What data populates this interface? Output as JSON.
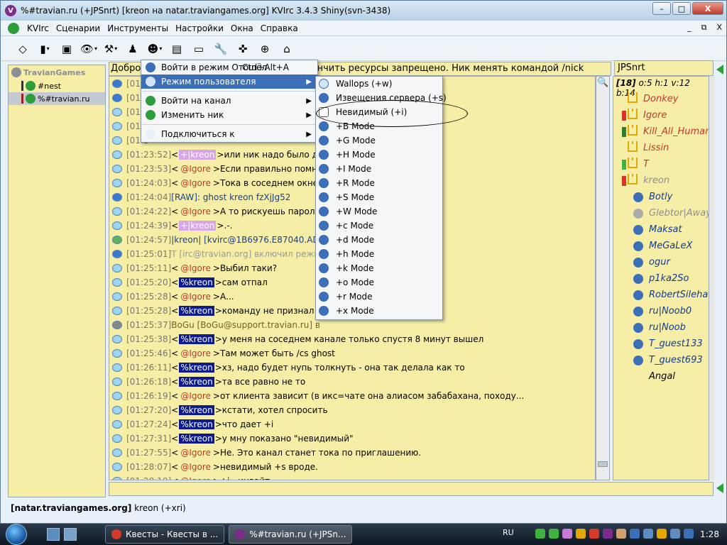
{
  "window": {
    "title": "%#travian.ru (+JPSnrt) [kreon на natar.traviangames.org] KVIrc 3.4.3 Shiny(svn-3438)",
    "app_icon_glyph": "V",
    "controls": [
      "–",
      "□",
      "X"
    ]
  },
  "menubar": {
    "items": [
      "KVIrc",
      "Сценарии",
      "Инструменты",
      "Настройки",
      "Окна",
      "Справка"
    ],
    "mdi_controls": [
      "_",
      "⧉",
      "X"
    ]
  },
  "toolbar": {
    "buttons": [
      {
        "name": "eraser-icon",
        "glyph": "◇"
      },
      {
        "name": "server-icon",
        "glyph": "▮"
      },
      {
        "name": "window-options-icon",
        "glyph": "▣"
      },
      {
        "name": "eye-icon",
        "glyph": "👁"
      },
      {
        "name": "tools-icon",
        "glyph": "⚒"
      },
      {
        "name": "joystick-icon",
        "glyph": "♟"
      },
      {
        "name": "user-icon",
        "glyph": "☻"
      },
      {
        "name": "notes-icon",
        "glyph": "▤"
      },
      {
        "name": "terminal-icon",
        "glyph": "▭"
      },
      {
        "name": "wrench-icon",
        "glyph": "🔧"
      },
      {
        "name": "tool-set-icon",
        "glyph": "✜"
      },
      {
        "name": "lifebuoy-icon",
        "glyph": "⊕"
      },
      {
        "name": "home-icon",
        "glyph": "⌂"
      }
    ]
  },
  "tree": {
    "root": "TravianGames",
    "items": [
      {
        "label": "#nest",
        "bar": "dark"
      },
      {
        "label": "%#travian.ru",
        "bar": "red",
        "selected": true
      }
    ]
  },
  "topic": "Добро пожаловать на канал Травиан! Клянчить ресурсы запрещено. Ник менять командой /nick",
  "chat": [
    {
      "type": "raw",
      "ts": "[01:2",
      "nick": "",
      "nick_class": "",
      "text": ""
    },
    {
      "type": "raw",
      "ts": "[01:2",
      "nick": "",
      "nick_class": "",
      "text": ""
    },
    {
      "type": "msg",
      "ts": "[01:2",
      "nick": "",
      "nick_class": "",
      "text": ""
    },
    {
      "type": "msg",
      "ts": "[01:2",
      "nick": "",
      "nick_class": "",
      "text": ""
    },
    {
      "type": "msg",
      "ts": "[01:2",
      "nick": "",
      "nick_class": "",
      "text": ""
    },
    {
      "type": "msg",
      "ts": "[01:23:52]",
      "nick": "+|kreon",
      "nick_class": "voice",
      "text": "или ник надо было дон"
    },
    {
      "type": "msg",
      "ts": "[01:23:53]",
      "nick": "@Igore",
      "nick_class": "op",
      "text": "Если правильно помн"
    },
    {
      "type": "msg",
      "ts": "[01:24:03]",
      "nick": "@Igore",
      "nick_class": "op",
      "text": "Тока в соседнем окне."
    },
    {
      "type": "raw",
      "ts": "[01:24:04]",
      "nick": "",
      "nick_class": "",
      "text": "[RAW]: ghost kreon fzXjJg52"
    },
    {
      "type": "msg",
      "ts": "[01:24:22]",
      "nick": "@Igore",
      "nick_class": "op",
      "text": "А то рискуешь пароль"
    },
    {
      "type": "msg",
      "ts": "[01:24:39]",
      "nick": "+|kreon",
      "nick_class": "voice",
      "text": ".-."
    },
    {
      "type": "join",
      "ts": "[01:24:57]",
      "nick": "",
      "nick_class": "",
      "text": "|kreon| [kvirc@1B6976.E87040.AD9                        н как kreon"
    },
    {
      "type": "raw",
      "ts": "[01:25:01]",
      "nick": "",
      "nick_class": "",
      "text": "T [irc@travian.org] включил режи"
    },
    {
      "type": "msg",
      "ts": "[01:25:11]",
      "nick": "@Igore",
      "nick_class": "op",
      "text": "Выбил таки?"
    },
    {
      "type": "msg",
      "ts": "[01:25:20]",
      "nick": "%kreon",
      "nick_class": "hop",
      "text": "сам отпал"
    },
    {
      "type": "msg",
      "ts": "[01:25:28]",
      "nick": "@Igore",
      "nick_class": "op",
      "text": "А..."
    },
    {
      "type": "msg",
      "ts": "[01:25:28]",
      "nick": "%kreon",
      "nick_class": "hop",
      "text": "команду не признал"
    },
    {
      "type": "sys",
      "ts": "[01:25:37]",
      "nick": "",
      "nick_class": "",
      "text": "BoGu [BoGu@support.travian.ru] в"
    },
    {
      "type": "msg",
      "ts": "[01:25:38]",
      "nick": "%kreon",
      "nick_class": "hop",
      "text": "у меня на соседнем канале только спустя 8 минут вышел"
    },
    {
      "type": "msg",
      "ts": "[01:25:46]",
      "nick": "@Igore",
      "nick_class": "op",
      "text": "Там может быть /cs ghost"
    },
    {
      "type": "msg",
      "ts": "[01:26:11]",
      "nick": "%kreon",
      "nick_class": "hop",
      "text": "хз, надо будет нупь толкнуть - она так делала как то"
    },
    {
      "type": "msg",
      "ts": "[01:26:18]",
      "nick": "%kreon",
      "nick_class": "hop",
      "text": "та все равно не то"
    },
    {
      "type": "msg",
      "ts": "[01:26:19]",
      "nick": "@Igore",
      "nick_class": "op",
      "text": "от клиента зависит (в икс=чате она алиасом забабахана, походу..."
    },
    {
      "type": "msg",
      "ts": "[01:27:20]",
      "nick": "%kreon",
      "nick_class": "hop",
      "text": "кстати, хотел спросить"
    },
    {
      "type": "msg",
      "ts": "[01:27:24]",
      "nick": "%kreon",
      "nick_class": "hop",
      "text": "что дает +i"
    },
    {
      "type": "msg",
      "ts": "[01:27:31]",
      "nick": "%kreon",
      "nick_class": "hop",
      "text": "у мну показано \"невидимый\""
    },
    {
      "type": "msg",
      "ts": "[01:27:55]",
      "nick": "@Igore",
      "nick_class": "op",
      "text": "Не. Это канал станет тока по приглашению."
    },
    {
      "type": "msg",
      "ts": "[01:28:07]",
      "nick": "@Igore",
      "nick_class": "op",
      "text": "невидимый +s вроде."
    },
    {
      "type": "msg",
      "ts": "[01:28:19]",
      "nick": "@Igore",
      "nick_class": "op",
      "text": "+i - инвайт"
    }
  ],
  "nick_field": "JPSnrt",
  "userlist": {
    "header_count": "[18]",
    "header_stats": "o:5 h:1 v:12 b:14",
    "users": [
      {
        "name": "Donkey",
        "kind": "op",
        "flag": ""
      },
      {
        "name": "Igore",
        "kind": "op",
        "flag": "#e0302a"
      },
      {
        "name": "Kill_All_Humans",
        "kind": "op",
        "flag": "#2e7d32"
      },
      {
        "name": "Lissin",
        "kind": "op",
        "flag": ""
      },
      {
        "name": "T",
        "kind": "op",
        "flag": "#3fb23f"
      },
      {
        "name": "kreon",
        "kind": "hop",
        "flag": "#e0302a"
      },
      {
        "name": "Botly",
        "kind": "reg",
        "flag": ""
      },
      {
        "name": "Glebtor|Away",
        "kind": "grey",
        "flag": ""
      },
      {
        "name": "Maksat",
        "kind": "reg",
        "flag": ""
      },
      {
        "name": "MeGaLeX",
        "kind": "reg",
        "flag": ""
      },
      {
        "name": "ogur",
        "kind": "reg",
        "flag": ""
      },
      {
        "name": "p1ka2So",
        "kind": "reg",
        "flag": ""
      },
      {
        "name": "RobertSilehardt",
        "kind": "reg",
        "flag": ""
      },
      {
        "name": "ru|Noob0",
        "kind": "reg",
        "flag": ""
      },
      {
        "name": "ru|Noob",
        "kind": "reg",
        "flag": ""
      },
      {
        "name": "T_guest133",
        "kind": "reg",
        "flag": ""
      },
      {
        "name": "T_guest693",
        "kind": "reg",
        "flag": ""
      },
      {
        "name": "Angal",
        "kind": "plain",
        "flag": ""
      }
    ]
  },
  "statusbar": {
    "server": "[natar.traviangames.org]",
    "nick": "kreon (+xri)"
  },
  "context_menu": {
    "items": [
      {
        "label": "Войти в режим Отошёл",
        "shortcut": "Ctrl+Alt+A",
        "icon_color": "#3b6fb8",
        "submenu": false,
        "highlighted": false
      },
      {
        "label": "Режим пользователя",
        "shortcut": "",
        "icon_color": "#cfe4f5",
        "submenu": true,
        "highlighted": true
      },
      {
        "sep": true
      },
      {
        "label": "Войти на канал",
        "shortcut": "",
        "icon_color": "#2e9d3a",
        "submenu": true,
        "highlighted": false
      },
      {
        "label": "Изменить ник",
        "shortcut": "",
        "icon_color": "#2e9d3a",
        "submenu": true,
        "highlighted": false
      },
      {
        "sep": true
      },
      {
        "label": "Подключиться к",
        "shortcut": "",
        "icon_color": "#e9f1f8",
        "submenu": true,
        "highlighted": false
      }
    ]
  },
  "submenu": {
    "items": [
      {
        "label": "Wallops (+w)",
        "icon": "wall"
      },
      {
        "label": "Извещения сервера (+s)",
        "icon": ""
      },
      {
        "label": "Невидимый (+i)",
        "icon": "inv"
      },
      {
        "label": "+B Mode",
        "icon": ""
      },
      {
        "label": "+G Mode",
        "icon": ""
      },
      {
        "label": "+H Mode",
        "icon": ""
      },
      {
        "label": "+I Mode",
        "icon": ""
      },
      {
        "label": "+R Mode",
        "icon": ""
      },
      {
        "label": "+S Mode",
        "icon": ""
      },
      {
        "label": "+W Mode",
        "icon": ""
      },
      {
        "label": "+c Mode",
        "icon": ""
      },
      {
        "label": "+d Mode",
        "icon": ""
      },
      {
        "label": "+h Mode",
        "icon": ""
      },
      {
        "label": "+k Mode",
        "icon": ""
      },
      {
        "label": "+o Mode",
        "icon": ""
      },
      {
        "label": "+r Mode",
        "icon": ""
      },
      {
        "label": "+x Mode",
        "icon": ""
      }
    ]
  },
  "taskbar": {
    "tasks": [
      {
        "label": "Квесты - Квесты в ...",
        "icon_color": "#d23b2a"
      },
      {
        "label": "%#travian.ru (+JPSn...",
        "icon_color": "#7b2c8c"
      }
    ],
    "lang": "RU",
    "tray_colors": [
      "#3fb23f",
      "#3fb23f",
      "#c77dd6",
      "#e0a800",
      "#d23b2a",
      "#7b2c8c",
      "#d0a070",
      "#3b6fb8",
      "#5d8cbf",
      "#e0a800",
      "#5d8cbf",
      "#3b6fb8"
    ],
    "clock": "1:28"
  }
}
